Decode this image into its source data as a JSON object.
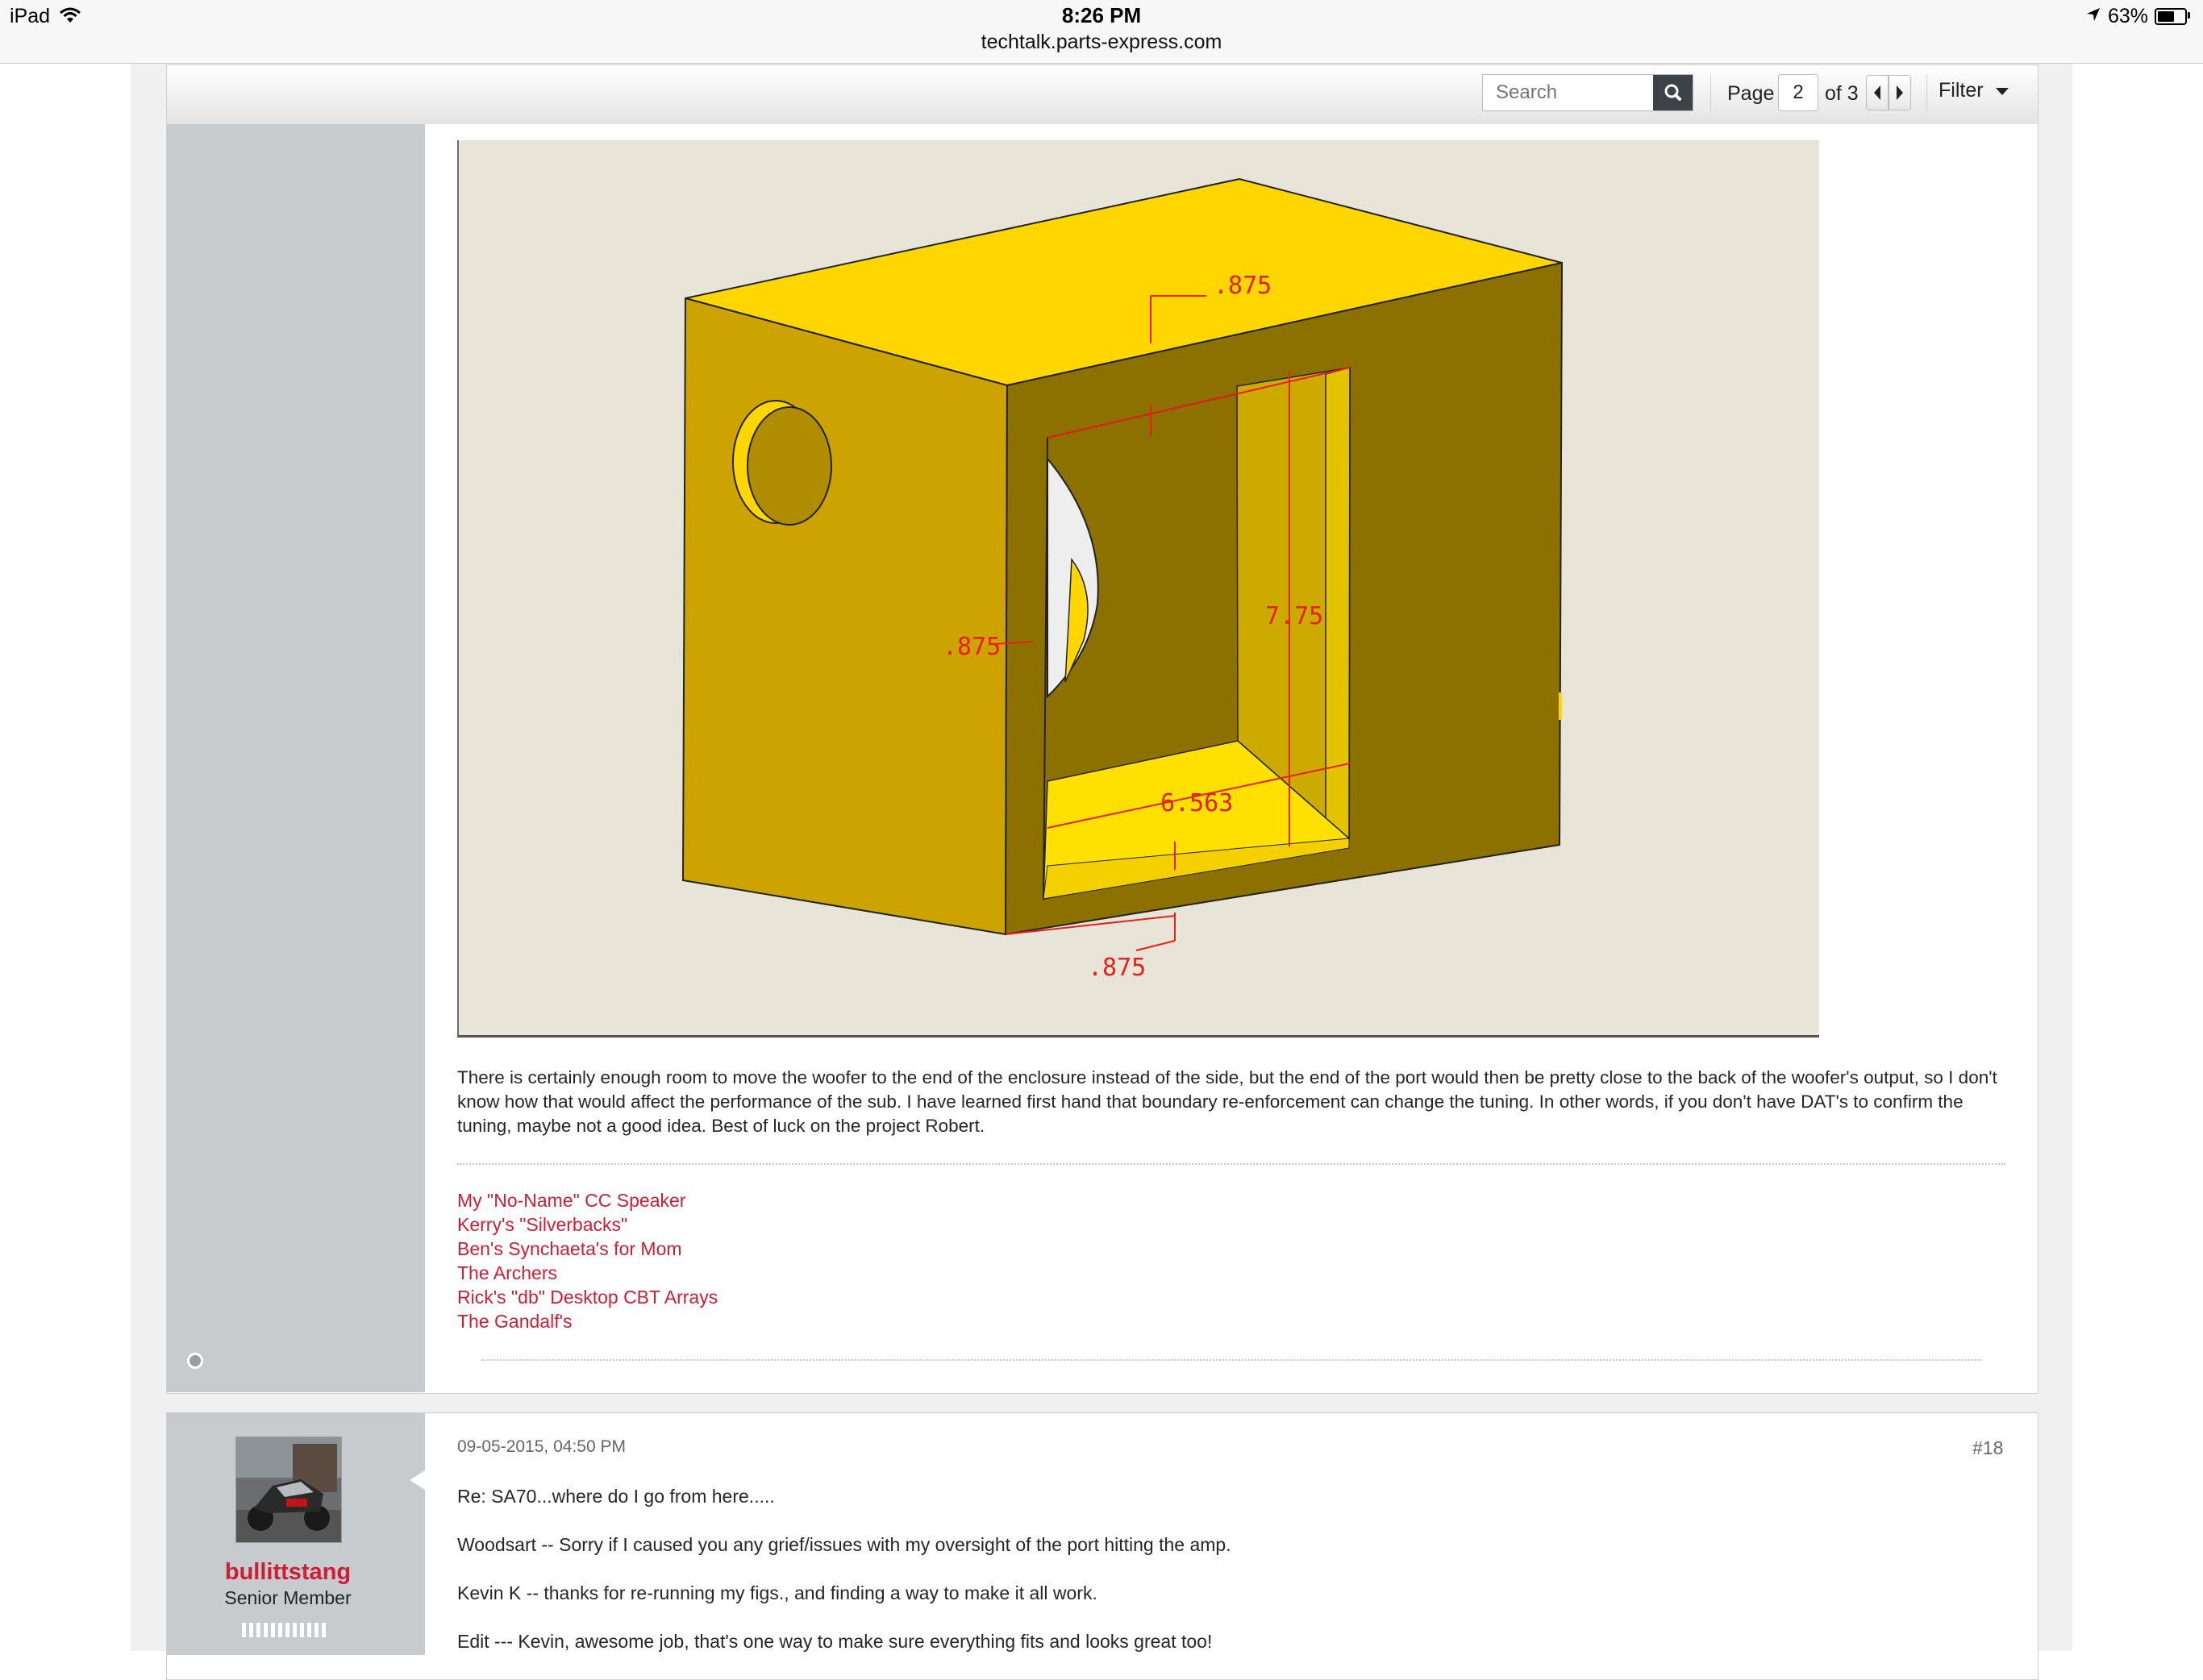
{
  "status_bar": {
    "device": "iPad",
    "time": "8:26 PM",
    "url": "techtalk.parts-express.com",
    "battery_percent": "63%",
    "battery_level": 0.63
  },
  "toolbar": {
    "search_placeholder": "Search",
    "page_label": "Page",
    "page_value": "2",
    "page_of": "of 3",
    "filter_label": "Filter"
  },
  "post1": {
    "drawing": {
      "dim_top": ".875",
      "dim_left": ".875",
      "dim_height": "7.75",
      "dim_width": "6.563",
      "dim_bottom": ".875"
    },
    "body": "There is certainly enough room to move the woofer to the end of the enclosure instead of the side, but the end of the port would then be pretty close to the back of the woofer's output, so I don't know how that would affect the performance of the sub. I have learned first hand that boundary re-enforcement can change the tuning. In other words, if you don't have DAT's to confirm the tuning, maybe not a good idea. Best of luck on the project Robert.",
    "signature_links": [
      "My \"No-Name\" CC Speaker",
      "Kerry's \"Silverbacks\"",
      "Ben's Synchaeta's for Mom",
      "The Archers",
      "Rick's \"db\" Desktop CBT Arrays",
      "The Gandalf's"
    ]
  },
  "post2": {
    "date": "09-05-2015, 04:50 PM",
    "number": "#18",
    "username": "bullittstang",
    "user_title": "Senior Member",
    "lines": [
      "Re: SA70...where do I go from here.....",
      "Woodsart -- Sorry if I caused you any grief/issues with my oversight of the port hitting the amp.",
      "Kevin K -- thanks for re-running my figs., and finding a way to make it all work.",
      "Edit --- Kevin, awesome job, that's one way to make sure everything fits and looks great too!"
    ]
  },
  "colors": {
    "link_red": "#cc1f36",
    "sidebar_gray": "#c8cbce",
    "box_top": "#ffd600",
    "box_side": "#cca300",
    "box_front": "#8c7000",
    "dimension_red": "#e8201b"
  },
  "icons": [
    "wifi-icon",
    "location-arrow-icon",
    "battery-icon",
    "search-icon",
    "prev-page-icon",
    "next-page-icon",
    "dropdown-caret-icon",
    "online-status-icon",
    "avatar"
  ]
}
